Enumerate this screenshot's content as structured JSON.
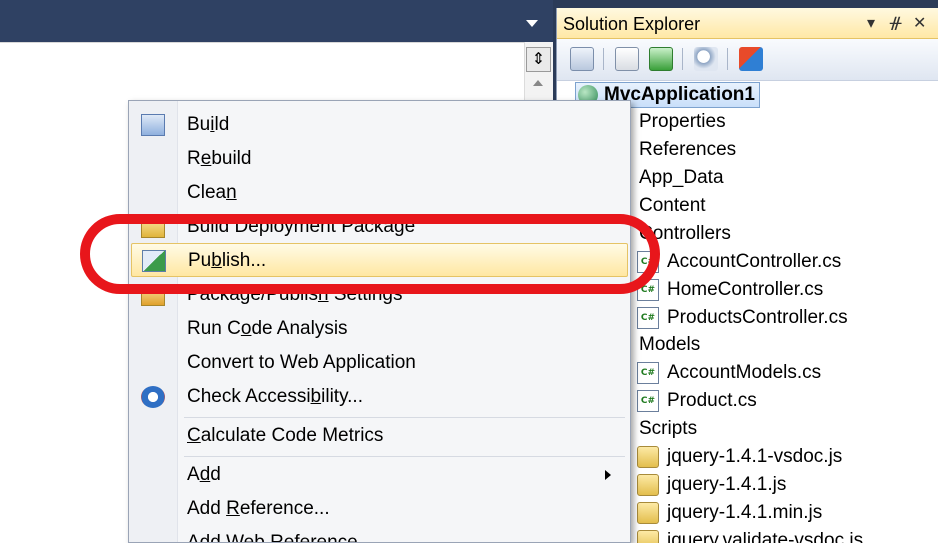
{
  "editor": {
    "split_glyph": "⇕"
  },
  "solution_explorer": {
    "title": "Solution Explorer",
    "title_buttons": [
      "▾",
      "ᚌ",
      "✕"
    ],
    "toolbar_icons": [
      "solution-icon",
      "properties-icon",
      "refresh-icon",
      "find-icon",
      "class-diagram-icon"
    ],
    "project": "MvcApplication1",
    "items": [
      {
        "label": "Properties",
        "icon": "folder-icon"
      },
      {
        "label": "References",
        "icon": "references-icon"
      },
      {
        "label": "App_Data",
        "icon": "folder-icon"
      },
      {
        "label": "Content",
        "icon": "folder-icon"
      },
      {
        "label": "Controllers",
        "icon": "folder-icon"
      },
      {
        "label": "AccountController.cs",
        "icon": "csharp-file-icon"
      },
      {
        "label": "HomeController.cs",
        "icon": "csharp-file-icon"
      },
      {
        "label": "ProductsController.cs",
        "icon": "csharp-file-icon"
      },
      {
        "label": "Models",
        "icon": "folder-icon"
      },
      {
        "label": "AccountModels.cs",
        "icon": "csharp-file-icon"
      },
      {
        "label": "Product.cs",
        "icon": "csharp-file-icon"
      },
      {
        "label": "Scripts",
        "icon": "folder-icon"
      },
      {
        "label": "jquery-1.4.1-vsdoc.js",
        "icon": "js-file-icon"
      },
      {
        "label": "jquery-1.4.1.js",
        "icon": "js-file-icon"
      },
      {
        "label": "jquery-1.4.1.min.js",
        "icon": "js-file-icon"
      },
      {
        "label": "jquery.validate-vsdoc.js",
        "icon": "js-file-icon"
      }
    ]
  },
  "context_menu": {
    "items": [
      {
        "pre": "Bu",
        "key": "i",
        "post": "ld",
        "icon": "build-icon"
      },
      {
        "pre": "R",
        "key": "e",
        "post": "build"
      },
      {
        "pre": "Clea",
        "key": "n",
        "post": ""
      },
      {
        "pre": "Build Deployment Packa",
        "key": "g",
        "post": "e",
        "icon": "package-icon"
      },
      {
        "pre": "Pu",
        "key": "b",
        "post": "lish...",
        "icon": "publish-icon",
        "highlighted": true
      },
      {
        "pre": "Package/Publis",
        "key": "h",
        "post": " Settings",
        "icon": "settings-icon"
      },
      {
        "pre": "Run C",
        "key": "o",
        "post": "de Analysis"
      },
      {
        "pre": "Convert to Web Application",
        "key": "",
        "post": ""
      },
      {
        "pre": "Check Accessi",
        "key": "b",
        "post": "ility...",
        "icon": "accessibility-icon"
      },
      {
        "pre": "",
        "key": "C",
        "post": "alculate Code Metrics"
      },
      {
        "pre": "A",
        "key": "d",
        "post": "d",
        "submenu": true
      },
      {
        "pre": "Add ",
        "key": "R",
        "post": "eference..."
      },
      {
        "pre": "Add Web Reference...",
        "key": "",
        "post": ""
      }
    ]
  },
  "colors": {
    "highlight_ring": "#e8161b",
    "menu_hover": "#ffe7a2"
  }
}
